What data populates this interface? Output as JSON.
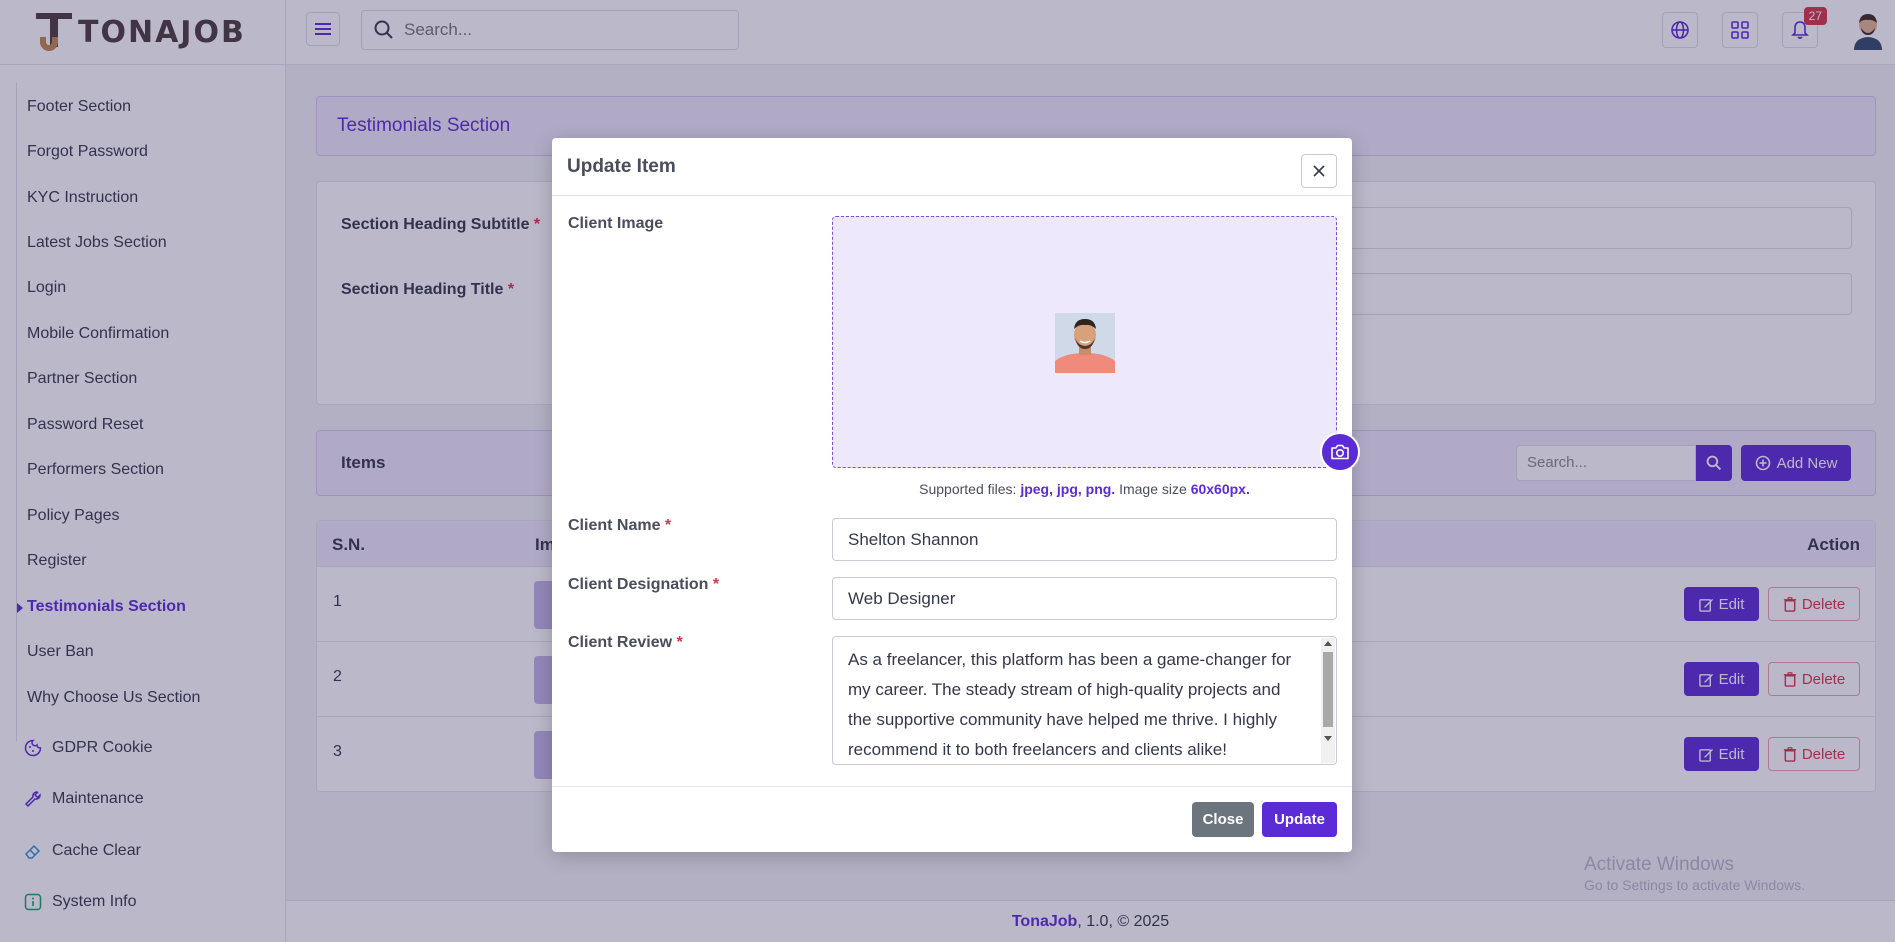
{
  "brand": {
    "logo_text": "TONAJOB"
  },
  "topbar": {
    "search_placeholder": "Search...",
    "notifications_count": "27",
    "icons": [
      "menu-icon",
      "search-icon",
      "globe-icon",
      "grid-icon",
      "bell-icon",
      "user-avatar"
    ]
  },
  "sidebar": {
    "items": [
      {
        "label": "Footer Section"
      },
      {
        "label": "Forgot Password"
      },
      {
        "label": "KYC Instruction"
      },
      {
        "label": "Latest Jobs Section"
      },
      {
        "label": "Login"
      },
      {
        "label": "Mobile Confirmation"
      },
      {
        "label": "Partner Section"
      },
      {
        "label": "Password Reset"
      },
      {
        "label": "Performers Section"
      },
      {
        "label": "Policy Pages"
      },
      {
        "label": "Register"
      },
      {
        "label": "Testimonials Section",
        "active": true
      },
      {
        "label": "User Ban"
      },
      {
        "label": "Why Choose Us Section"
      }
    ],
    "groups": [
      {
        "label": "GDPR Cookie",
        "icon": "cookie-icon"
      },
      {
        "label": "Maintenance",
        "icon": "wrench-icon"
      },
      {
        "label": "Cache Clear",
        "icon": "eraser-icon"
      },
      {
        "label": "System Info",
        "icon": "info-icon"
      }
    ]
  },
  "page": {
    "title": "Testimonials Section",
    "form": {
      "subtitle_label": "Section Heading Subtitle",
      "title_label": "Section Heading Title",
      "required_mark": "*"
    },
    "items": {
      "label": "Items",
      "search_placeholder": "Search...",
      "add_new": "Add New",
      "columns": {
        "sn": "S.N.",
        "image": "Im",
        "action": "Action"
      },
      "rows": [
        {
          "sn": "1"
        },
        {
          "sn": "2"
        },
        {
          "sn": "3"
        }
      ],
      "edit_label": "Edit",
      "delete_label": "Delete"
    }
  },
  "modal": {
    "title": "Update Item",
    "client_image_label": "Client Image",
    "supported_prefix": "Supported files:",
    "supported_types": "jpeg, jpg, png.",
    "image_size_prefix": "Image size",
    "image_size": "60x60px.",
    "client_name_label": "Client Name",
    "client_name_value": "Shelton Shannon",
    "client_designation_label": "Client Designation",
    "client_designation_value": "Web Designer",
    "client_review_label": "Client Review",
    "client_review_value": "As a freelancer, this platform has been a game-changer for my career. The steady stream of high-quality projects and the supportive community have helped me thrive. I highly recommend it to both freelancers and clients alike!",
    "close_label": "Close",
    "update_label": "Update",
    "required_mark": "*"
  },
  "watermark": {
    "line1": "Activate Windows",
    "line2": "Go to Settings to activate Windows."
  },
  "footer": {
    "brand": "TonaJob",
    "rest": ", 1.0, © 2025"
  },
  "colors": {
    "accent": "#5b2bd6",
    "danger": "#d63545",
    "secondary": "#6c757d"
  }
}
